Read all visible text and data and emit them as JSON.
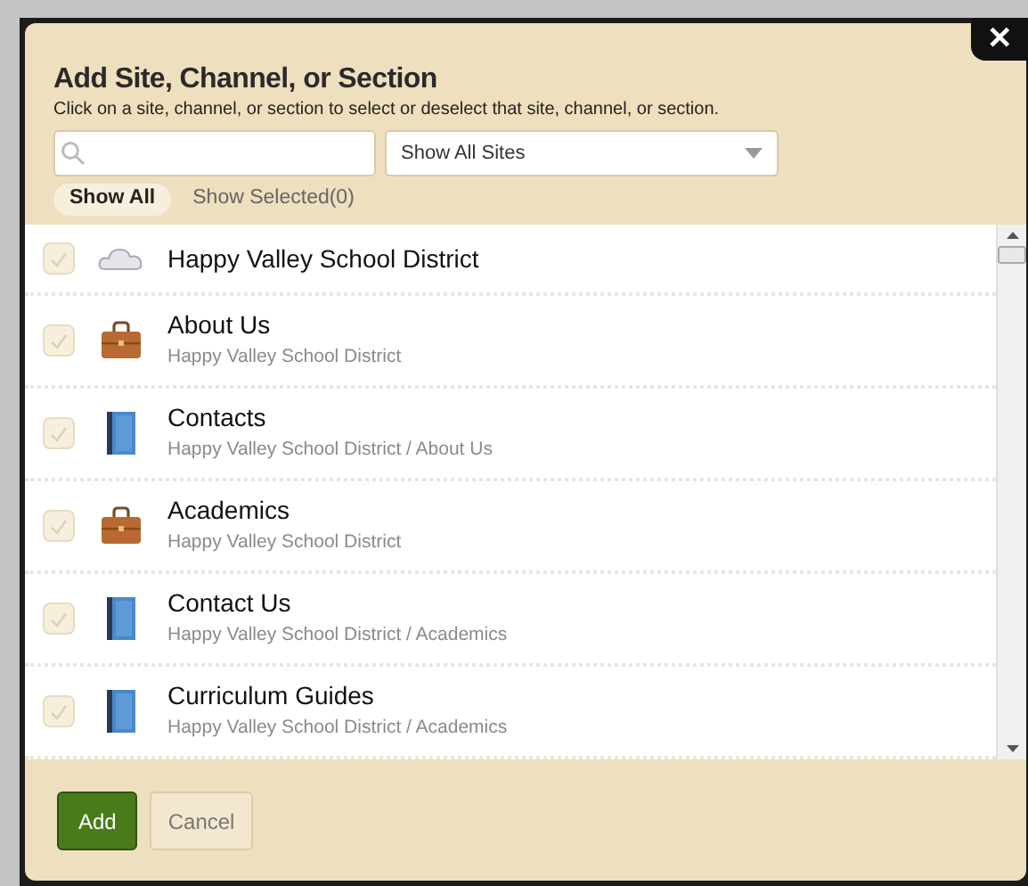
{
  "dialog": {
    "title": "Add Site, Channel, or Section",
    "instructions": "Click on a site, channel, or section to select or deselect that site, channel, or section.",
    "close": "✕"
  },
  "site_filter": {
    "value": "Show All Sites"
  },
  "tabs": [
    {
      "label": "Show All",
      "selected": true
    },
    {
      "label": "Show Selected(0)",
      "selected": false
    }
  ],
  "items": [
    {
      "kind": "site",
      "title": "Happy Valley School District",
      "checked": false
    },
    {
      "kind": "channel",
      "title": "About Us",
      "path": "Happy Valley School District",
      "checked": false
    },
    {
      "kind": "section",
      "title": "Contacts",
      "path": "Happy Valley School District / About Us",
      "checked": false
    },
    {
      "kind": "channel",
      "title": "Academics",
      "path": "Happy Valley School District",
      "checked": false
    },
    {
      "kind": "section",
      "title": "Contact Us",
      "path": "Happy Valley School District / Academics",
      "checked": false
    },
    {
      "kind": "section",
      "title": "Curriculum Guides",
      "path": "Happy Valley School District / Academics",
      "checked": false
    }
  ],
  "buttons": [
    {
      "label": "Add",
      "kind": "primary"
    },
    {
      "label": "Cancel",
      "kind": "secondary"
    }
  ]
}
